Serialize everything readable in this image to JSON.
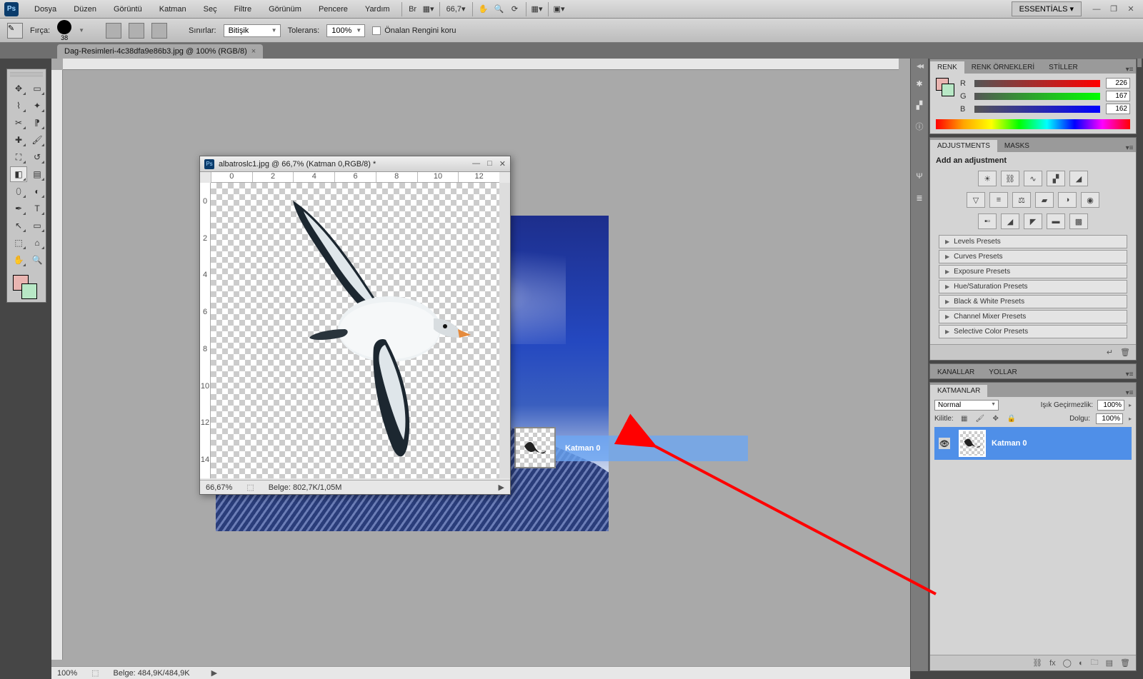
{
  "menu": [
    "Dosya",
    "Düzen",
    "Görüntü",
    "Katman",
    "Seç",
    "Filtre",
    "Görünüm",
    "Pencere",
    "Yardım"
  ],
  "zoom_menu": "66,7",
  "essentials": "ESSENTİALS ▾",
  "options": {
    "brush_label": "Fırça:",
    "brush_size": "38",
    "limits_label": "Sınırlar:",
    "limits_value": "Bitişik",
    "tolerance_label": "Tolerans:",
    "tolerance_value": "100%",
    "protect_fg": "Önalan Rengini koru"
  },
  "tabs": {
    "main": "Dag-Resimleri-4c38dfa9e86b3.jpg @ 100% (RGB/8)"
  },
  "float": {
    "title": "albatroslc1.jpg @ 66,7% (Katman 0,RGB/8) *",
    "zoom": "66,67%",
    "doc": "Belge: 802,7K/1,05M",
    "hticks": [
      "0",
      "2",
      "4",
      "6",
      "8",
      "10",
      "12"
    ],
    "vticks": [
      "0",
      "2",
      "4",
      "6",
      "8",
      "10",
      "12",
      "14"
    ]
  },
  "drag_label": "Katman 0",
  "color_panel": {
    "tabs": [
      "RENK",
      "RENK ÖRNEKLERİ",
      "STİLLER"
    ],
    "r": "226",
    "g": "167",
    "b": "162"
  },
  "adjust": {
    "tabs": [
      "ADJUSTMENTS",
      "MASKS"
    ],
    "title": "Add an adjustment",
    "presets": [
      "Levels Presets",
      "Curves Presets",
      "Exposure Presets",
      "Hue/Saturation Presets",
      "Black & White Presets",
      "Channel Mixer Presets",
      "Selective Color Presets"
    ]
  },
  "paths_tabs": [
    "KANALLAR",
    "YOLLAR"
  ],
  "layers": {
    "tab": "KATMANLAR",
    "mode": "Normal",
    "opacity_label": "Işık Geçirmezlik:",
    "opacity": "100%",
    "lock_label": "Kilitle:",
    "fill_label": "Dolgu:",
    "fill": "100%",
    "layer_name": "Katman 0"
  },
  "main_status": {
    "zoom": "100%",
    "doc": "Belge: 484,9K/484,9K"
  }
}
